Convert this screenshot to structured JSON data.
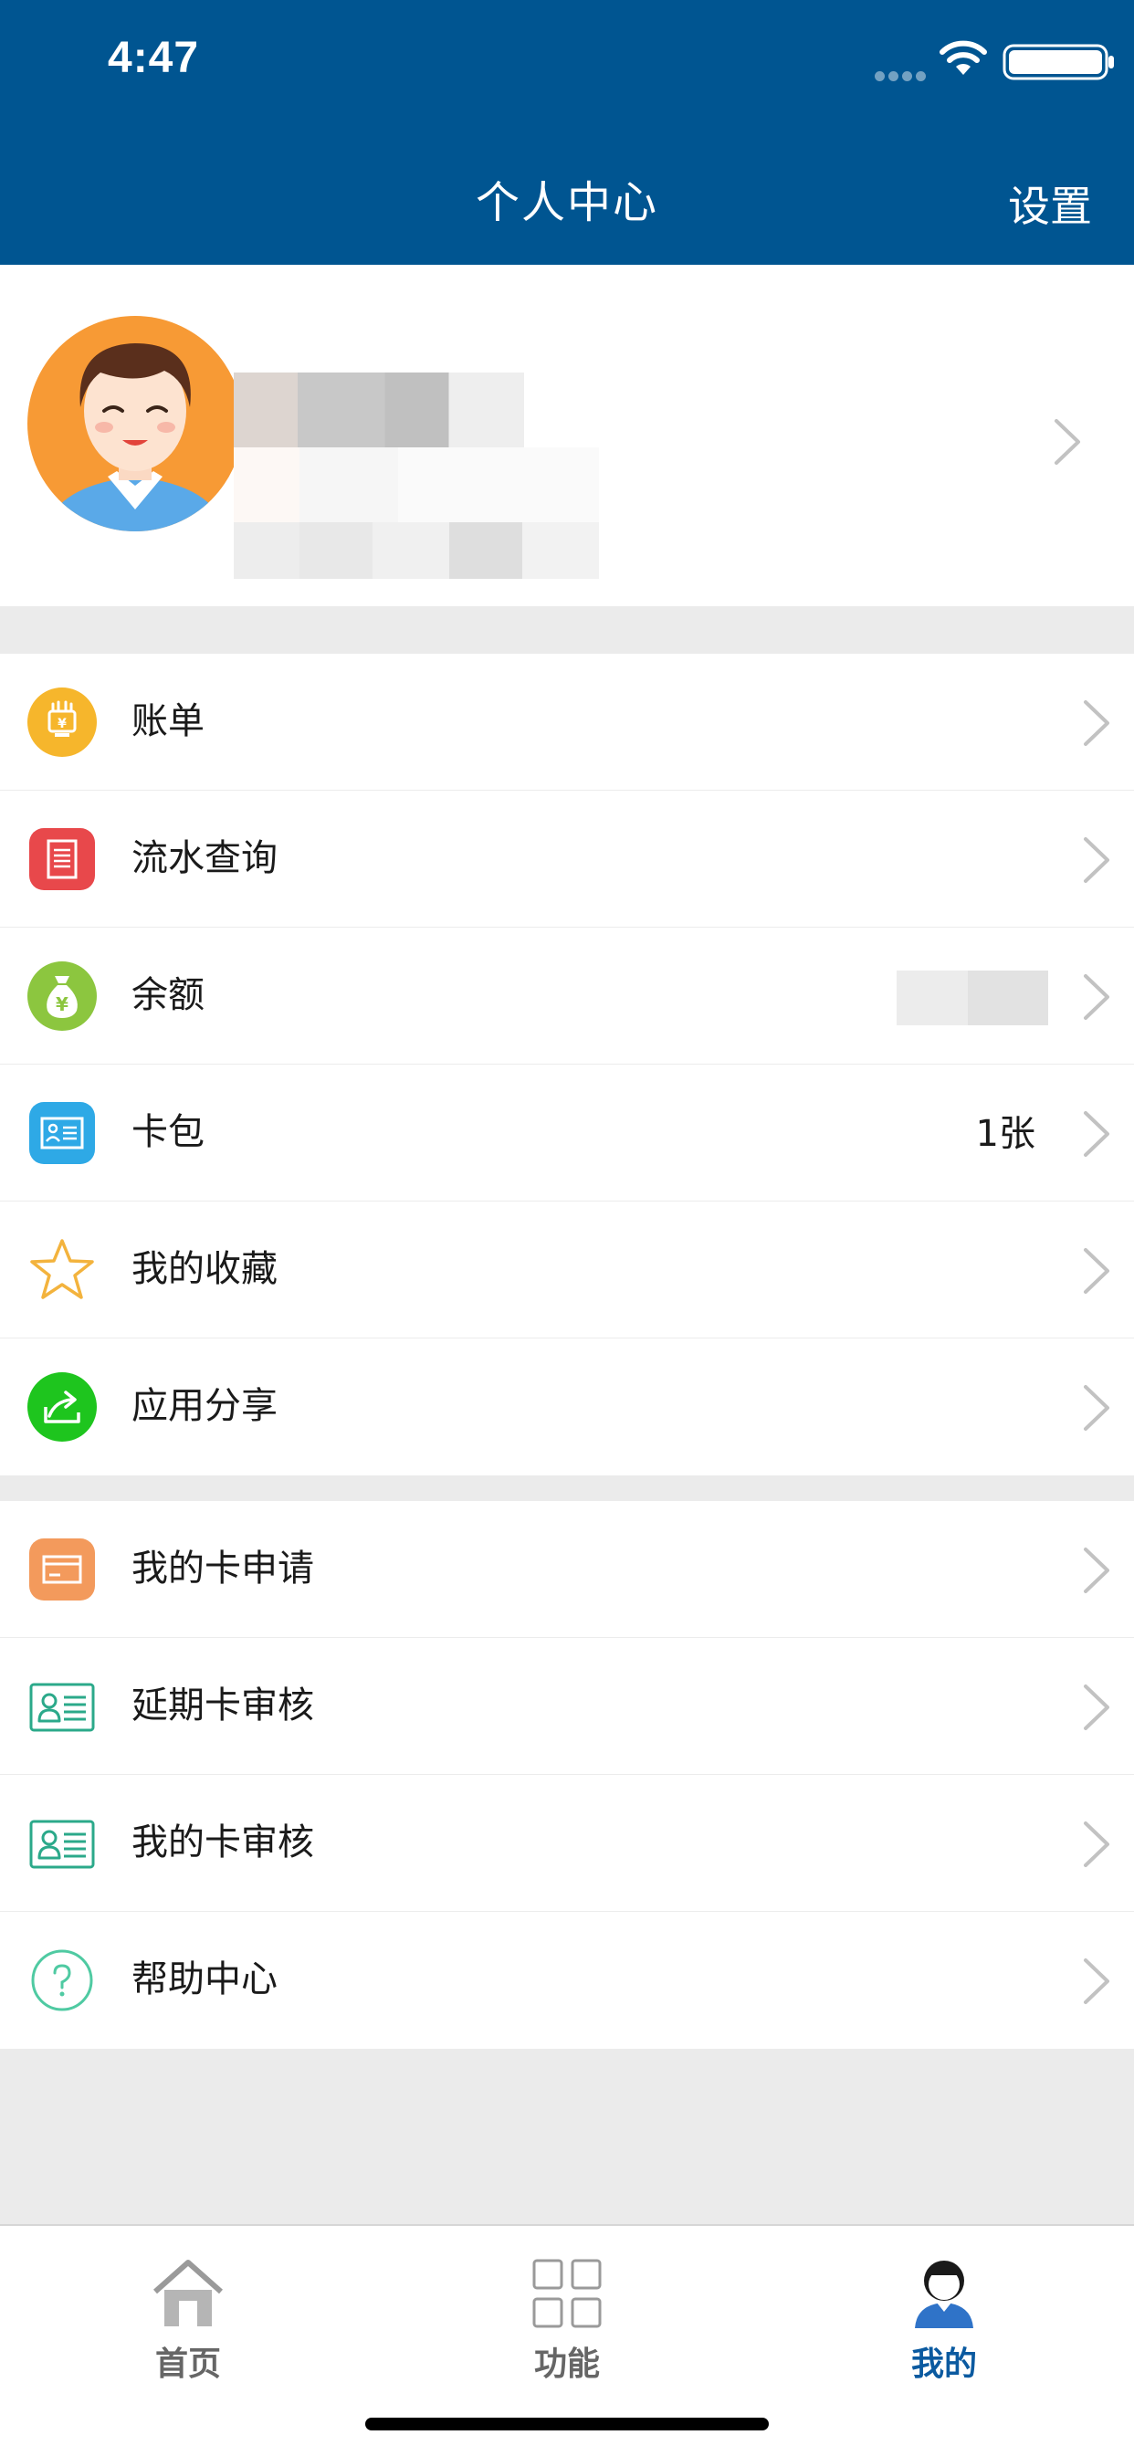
{
  "status_bar": {
    "time": "4:47"
  },
  "nav": {
    "title": "个人中心",
    "settings_label": "设置"
  },
  "colors": {
    "primary": "#005591",
    "background": "#ebebeb",
    "active_tab": "#0b5aa0"
  },
  "menu_group_1": [
    {
      "label": "账单",
      "icon": "bill-icon"
    },
    {
      "label": "流水查询",
      "icon": "transaction-query-icon"
    },
    {
      "label": "余额",
      "icon": "money-bag-icon"
    },
    {
      "label": "卡包",
      "icon": "card-wallet-icon",
      "value": "1张"
    },
    {
      "label": "我的收藏",
      "icon": "star-icon"
    },
    {
      "label": "应用分享",
      "icon": "share-icon"
    }
  ],
  "menu_group_2": [
    {
      "label": "我的卡申请",
      "icon": "card-apply-icon"
    },
    {
      "label": "延期卡审核",
      "icon": "id-card-review-icon"
    },
    {
      "label": "我的卡审核",
      "icon": "id-card-review-icon"
    },
    {
      "label": "帮助中心",
      "icon": "help-icon"
    }
  ],
  "tab_bar": [
    {
      "label": "首页",
      "icon": "home-icon",
      "active": false
    },
    {
      "label": "功能",
      "icon": "grid-icon",
      "active": false
    },
    {
      "label": "我的",
      "icon": "user-icon",
      "active": true
    }
  ]
}
